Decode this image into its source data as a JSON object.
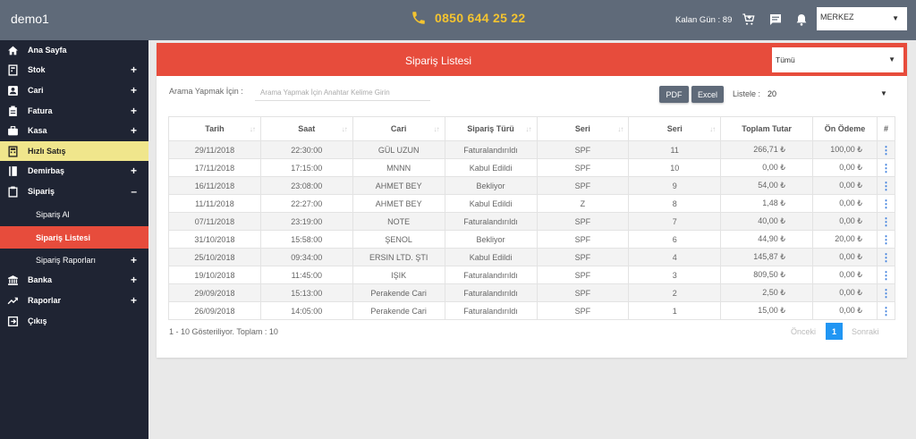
{
  "app": {
    "brand": "demo1",
    "phone": "0850 644 25 22",
    "days_left": "Kalan Gün : 89",
    "branch": "MERKEZ"
  },
  "icons": {
    "phone": "phone-icon",
    "cart": "cart-icon",
    "message": "message-icon",
    "bell": "bell-icon"
  },
  "colors": {
    "topbar": "#5f6a79",
    "sidebar": "#1f2433",
    "accent_red": "#e74c3c",
    "highlight_yellow": "#f0e68c",
    "phone_yellow": "#f4c430",
    "page_blue": "#2196f3"
  },
  "sidebar": {
    "items": [
      {
        "label": "Ana Sayfa",
        "icon": "home-icon",
        "expand": ""
      },
      {
        "label": "Stok",
        "icon": "stock-icon",
        "expand": "+"
      },
      {
        "label": "Cari",
        "icon": "contact-icon",
        "expand": "+"
      },
      {
        "label": "Fatura",
        "icon": "invoice-icon",
        "expand": "+"
      },
      {
        "label": "Kasa",
        "icon": "briefcase-icon",
        "expand": "+"
      },
      {
        "label": "Hızlı Satış",
        "icon": "calculator-icon",
        "expand": ""
      },
      {
        "label": "Demirbaş",
        "icon": "book-icon",
        "expand": "+"
      },
      {
        "label": "Sipariş",
        "icon": "clipboard-icon",
        "expand": "–"
      },
      {
        "label": "Sipariş Al",
        "icon": "",
        "expand": ""
      },
      {
        "label": "Sipariş Listesi",
        "icon": "",
        "expand": ""
      },
      {
        "label": "Sipariş Raporları",
        "icon": "",
        "expand": "+"
      },
      {
        "label": "Banka",
        "icon": "bank-icon",
        "expand": "+"
      },
      {
        "label": "Raporlar",
        "icon": "trend-icon",
        "expand": "+"
      },
      {
        "label": "Çıkış",
        "icon": "logout-icon",
        "expand": ""
      }
    ]
  },
  "page": {
    "title": "Sipariş Listesi",
    "filter_value": "Tümü",
    "search_label": "Arama Yapmak İçin :",
    "search_placeholder": "Arama Yapmak İçin Anahtar Kelime Girin",
    "pdf_label": "PDF",
    "excel_label": "Excel",
    "page_size_label": "Listele :",
    "page_size_value": "20"
  },
  "table": {
    "columns": [
      "Tarih",
      "Saat",
      "Cari",
      "Sipariş Türü",
      "Seri",
      "Seri",
      "Toplam Tutar",
      "Ön Ödeme",
      "#"
    ],
    "rows": [
      [
        "29/11/2018",
        "22:30:00",
        "GÜL UZUN",
        "Faturalandırıldı",
        "SPF",
        "11",
        "266,71 ₺",
        "100,00 ₺"
      ],
      [
        "17/11/2018",
        "17:15:00",
        "MNNN",
        "Kabul Edildi",
        "SPF",
        "10",
        "0,00 ₺",
        "0,00 ₺"
      ],
      [
        "16/11/2018",
        "23:08:00",
        "AHMET BEY",
        "Bekliyor",
        "SPF",
        "9",
        "54,00 ₺",
        "0,00 ₺"
      ],
      [
        "11/11/2018",
        "22:27:00",
        "AHMET BEY",
        "Kabul Edildi",
        "Z",
        "8",
        "1,48 ₺",
        "0,00 ₺"
      ],
      [
        "07/11/2018",
        "23:19:00",
        "NOTE",
        "Faturalandırıldı",
        "SPF",
        "7",
        "40,00 ₺",
        "0,00 ₺"
      ],
      [
        "31/10/2018",
        "15:58:00",
        "ŞENOL",
        "Bekliyor",
        "SPF",
        "6",
        "44,90 ₺",
        "20,00 ₺"
      ],
      [
        "25/10/2018",
        "09:34:00",
        "ERSIN LTD. ŞTI",
        "Kabul Edildi",
        "SPF",
        "4",
        "145,87 ₺",
        "0,00 ₺"
      ],
      [
        "19/10/2018",
        "11:45:00",
        "IŞIK",
        "Faturalandırıldı",
        "SPF",
        "3",
        "809,50 ₺",
        "0,00 ₺"
      ],
      [
        "29/09/2018",
        "15:13:00",
        "Perakende Cari",
        "Faturalandırıldı",
        "SPF",
        "2",
        "2,50 ₺",
        "0,00 ₺"
      ],
      [
        "26/09/2018",
        "14:05:00",
        "Perakende Cari",
        "Faturalandırıldı",
        "SPF",
        "1",
        "15,00 ₺",
        "0,00 ₺"
      ]
    ],
    "row_action": "⋮"
  },
  "pagination": {
    "summary": "1 - 10 Gösteriliyor. Toplam : 10",
    "prev": "Önceki",
    "current": "1",
    "next": "Sonraki"
  }
}
